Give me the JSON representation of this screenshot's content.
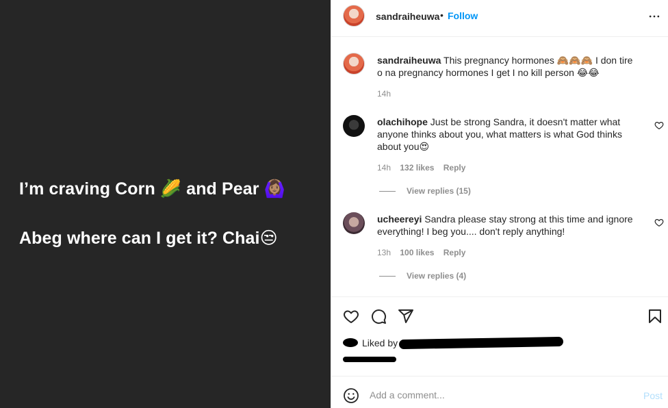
{
  "media": {
    "story_line_1": "I’m craving Corn 🌽 and Pear 🙆🏽‍♀️",
    "story_line_2": "Abeg where can I get it? Chai😒",
    "background": "#262626"
  },
  "header": {
    "username": "sandraiheuwa",
    "separator": "•",
    "follow_label": "Follow",
    "more_icon": "more-horizontal-icon"
  },
  "comments": [
    {
      "username": "sandraiheuwa",
      "text": "This pregnancy hormones 🙈🙈🙈 I don tire o na pregnancy hormones I get I no kill person 😂😂",
      "time": "14h"
    },
    {
      "username": "olachihope",
      "text": "Just be strong Sandra, it doesn't matter what anyone thinks about you, what matters is what God thinks about you😍",
      "time": "14h",
      "likes": "132 likes",
      "reply_label": "Reply",
      "view_replies": "View replies (15)"
    },
    {
      "username": "ucheereyi",
      "text": "Sandra please stay strong at this time and ignore everything! I beg you.... don't reply anything!",
      "time": "13h",
      "likes": "100 likes",
      "reply_label": "Reply",
      "view_replies": "View replies (4)"
    }
  ],
  "actions": {
    "like_icon": "heart-icon",
    "comment_icon": "comment-icon",
    "share_icon": "send-icon",
    "save_icon": "bookmark-icon"
  },
  "liked_by": {
    "prefix": "Liked by"
  },
  "add_comment": {
    "placeholder": "Add a comment...",
    "post_label": "Post",
    "emoji_icon": "emoji-icon"
  },
  "colors": {
    "accent": "#0095f6",
    "post_disabled": "#b2dffc",
    "muted": "#8e8e8e",
    "text": "#262626"
  }
}
